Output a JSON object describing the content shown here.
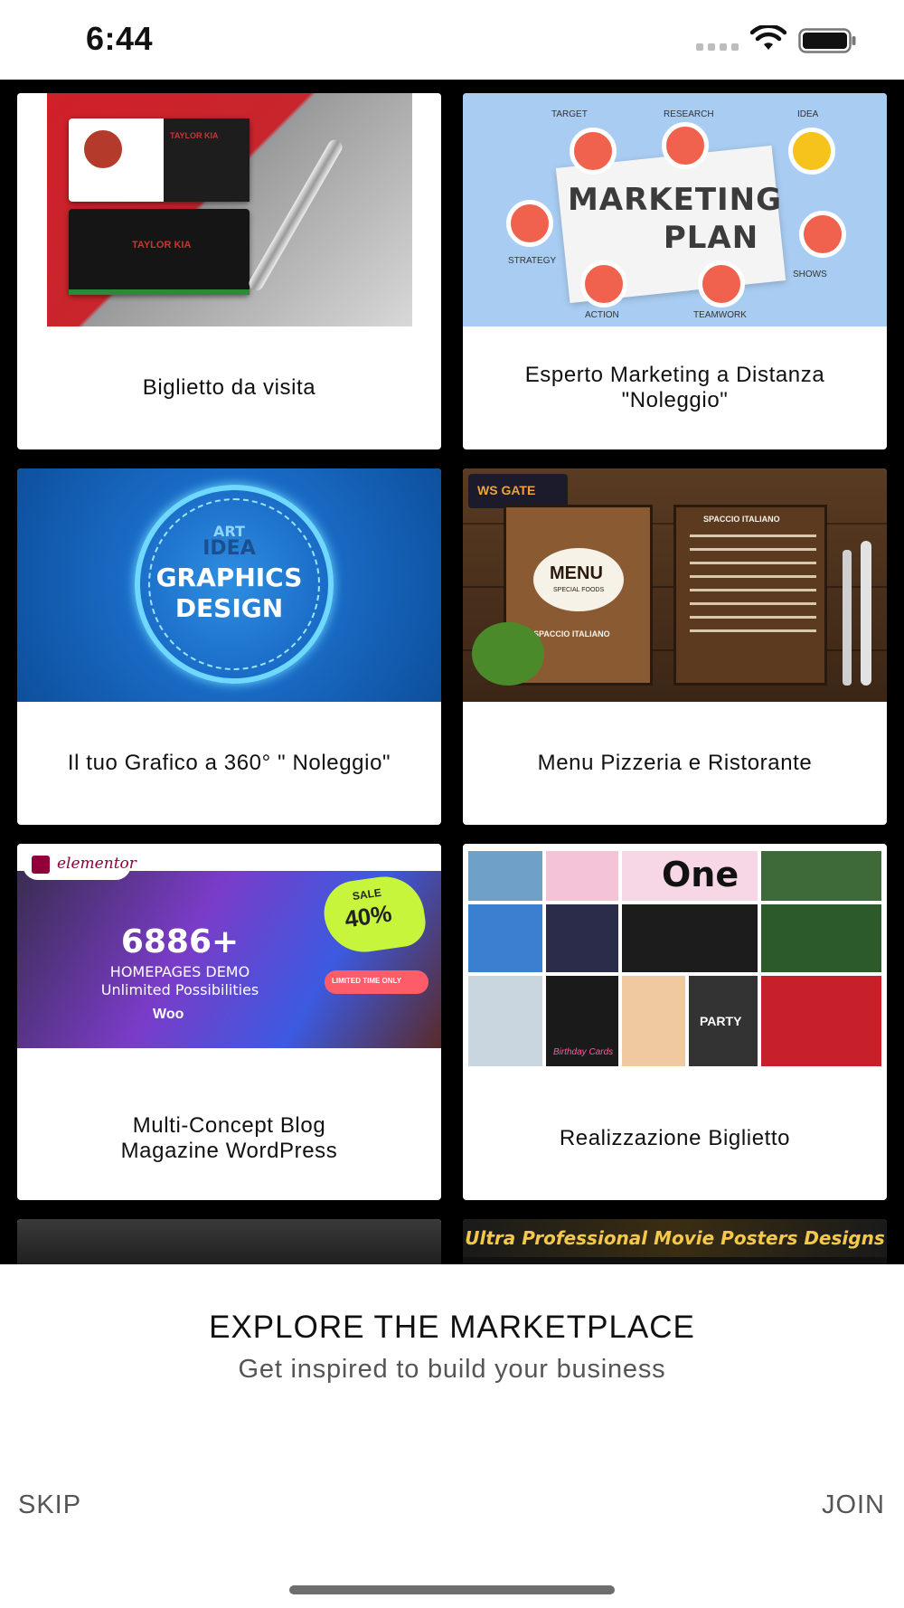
{
  "status_bar": {
    "time": "6:44",
    "icons": [
      "cellular-signal-icon",
      "wifi-icon",
      "battery-icon"
    ]
  },
  "marketplace": {
    "cards": [
      {
        "title": "Biglietto da visita",
        "thumb_text": [
          "TAYLOR KIA",
          "TAYLOR KIA"
        ]
      },
      {
        "title": "Esperto Marketing a Distanza \"Noleggio\"",
        "thumb_text": [
          "MARKETING",
          "PLAN",
          "TARGET",
          "RESEARCH",
          "IDEA",
          "STRATEGY",
          "ACTION",
          "TEAMWORK",
          "SHOWS"
        ]
      },
      {
        "title": "Il tuo Grafico a 360° \" Noleggio\"",
        "thumb_text": [
          "ART",
          "IDEA",
          "GRAPHICS",
          "DESIGN"
        ]
      },
      {
        "title": "Menu Pizzeria e Ristorante",
        "thumb_text": [
          "WS GATE",
          "MENU",
          "SPECIAL FOODS",
          "SPACCIO ITALIANO",
          "SPACCIO ITALIANO"
        ]
      },
      {
        "title": "Multi-Concept  Blog\nMagazine WordPress",
        "thumb_text": [
          "elementor",
          "6886+",
          "HOMEPAGES DEMO",
          "Unlimited Possibilities",
          "SALE",
          "40%",
          "LIMITED TIME ONLY",
          "Woo"
        ]
      },
      {
        "title": "Realizzazione Biglietto",
        "thumb_text": [
          "One",
          "Birthday Cards",
          "PARTY"
        ]
      }
    ],
    "partial_cards": [
      {
        "thumb_text": ""
      },
      {
        "thumb_text": "Ultra Professional Movie Posters Designs"
      }
    ]
  },
  "onboarding": {
    "headline": "EXPLORE THE MARKETPLACE",
    "subline": "Get inspired to build your business",
    "skip_label": "SKIP",
    "join_label": "JOIN"
  }
}
